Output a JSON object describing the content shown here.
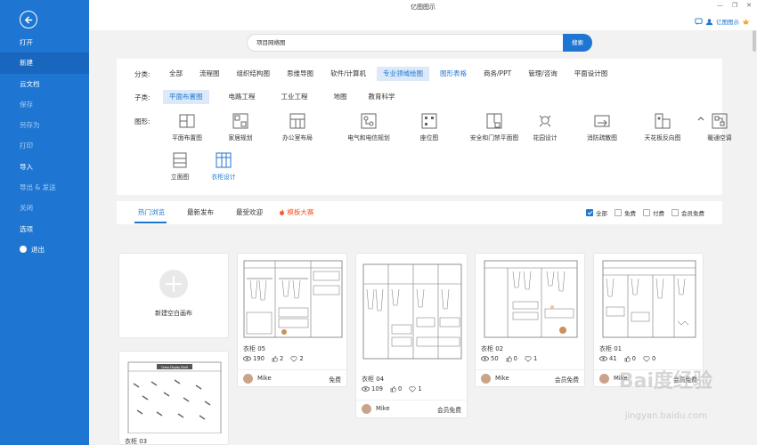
{
  "window": {
    "title": "亿图图示",
    "controls": [
      "—",
      "❐",
      "✕"
    ]
  },
  "brand": {
    "name": "亿图图示"
  },
  "sidebar": {
    "items": [
      {
        "label": "打开",
        "style": "normal"
      },
      {
        "label": "新建",
        "style": "active"
      },
      {
        "label": "云文档",
        "style": "normal"
      },
      {
        "label": "保存",
        "style": "dim"
      },
      {
        "label": "另存为",
        "style": "dim"
      },
      {
        "label": "打印",
        "style": "dim"
      },
      {
        "label": "导入",
        "style": "normal"
      },
      {
        "label": "导出 & 发送",
        "style": "dim"
      },
      {
        "label": "关闭",
        "style": "dim"
      },
      {
        "label": "选项",
        "style": "normal"
      },
      {
        "label": "退出",
        "style": "exit"
      }
    ]
  },
  "search": {
    "value": "项目网络图",
    "button": "搜索"
  },
  "filters": {
    "category_label": "分类:",
    "categories": [
      {
        "label": "全部",
        "state": "normal"
      },
      {
        "label": "流程图",
        "state": "normal"
      },
      {
        "label": "组织结构图",
        "state": "normal"
      },
      {
        "label": "思维导图",
        "state": "normal"
      },
      {
        "label": "软件/计算机",
        "state": "normal"
      },
      {
        "label": "专业领域绘图",
        "state": "active"
      },
      {
        "label": "图形表格",
        "state": "blue"
      },
      {
        "label": "商务/PPT",
        "state": "normal"
      },
      {
        "label": "管理/咨询",
        "state": "normal"
      },
      {
        "label": "平面设计图",
        "state": "normal"
      }
    ],
    "subcategory_label": "子类:",
    "subcategories": [
      {
        "label": "平面布置图",
        "state": "active"
      },
      {
        "label": "电路工程",
        "state": "normal"
      },
      {
        "label": "工业工程",
        "state": "normal"
      },
      {
        "label": "地图",
        "state": "normal"
      },
      {
        "label": "教育科学",
        "state": "normal"
      }
    ],
    "shapes_label": "图形:",
    "shapes": [
      {
        "label": "平面布置图",
        "icon": "floorplan-icon"
      },
      {
        "label": "家居规划",
        "icon": "home-plan-icon"
      },
      {
        "label": "办公室布局",
        "icon": "office-layout-icon"
      },
      {
        "label": "电气和电信规划",
        "icon": "electrical-plan-icon"
      },
      {
        "label": "座位图",
        "icon": "seating-icon"
      },
      {
        "label": "安全和门禁平面图",
        "icon": "security-plan-icon"
      },
      {
        "label": "花园设计",
        "icon": "garden-icon"
      },
      {
        "label": "消防疏散图",
        "icon": "fire-escape-icon"
      },
      {
        "label": "天花板反向图",
        "icon": "ceiling-icon"
      },
      {
        "label": "暖通空调",
        "icon": "hvac-icon"
      },
      {
        "label": "立面图",
        "icon": "elevation-icon"
      },
      {
        "label": "衣柜设计",
        "icon": "wardrobe-icon",
        "selected": true
      }
    ]
  },
  "tabs": {
    "items": [
      {
        "label": "热门浏览",
        "state": "active"
      },
      {
        "label": "最新发布",
        "state": "normal"
      },
      {
        "label": "最受欢迎",
        "state": "normal"
      },
      {
        "label": "模板大赛",
        "state": "hot"
      }
    ],
    "checks": [
      {
        "label": "全部",
        "checked": true
      },
      {
        "label": "免费",
        "checked": false
      },
      {
        "label": "付费",
        "checked": false
      },
      {
        "label": "会员免费",
        "checked": false
      }
    ]
  },
  "blank_card": {
    "label": "新建空白画布"
  },
  "cards": [
    {
      "title": "衣柜 05",
      "views": "190",
      "likes": "2",
      "favs": "2",
      "author": "Mike",
      "price": "免费"
    },
    {
      "title": "衣柜 04",
      "views": "109",
      "likes": "0",
      "favs": "1",
      "author": "Mike",
      "price": "会员免费"
    },
    {
      "title": "衣柜 02",
      "views": "50",
      "likes": "0",
      "favs": "1",
      "author": "Mike",
      "price": "会员免费"
    },
    {
      "title": "衣柜 01",
      "views": "41",
      "likes": "0",
      "favs": "0",
      "author": "Mike",
      "price": "会员免费"
    },
    {
      "title": "衣柜 03"
    }
  ],
  "card3_banner": "Dress Display Shelf",
  "watermark": {
    "logo": "Bai度经验",
    "url": "jingyan.baidu.com"
  },
  "colors": {
    "accent": "#1f76d2",
    "hot": "#f05a28"
  }
}
